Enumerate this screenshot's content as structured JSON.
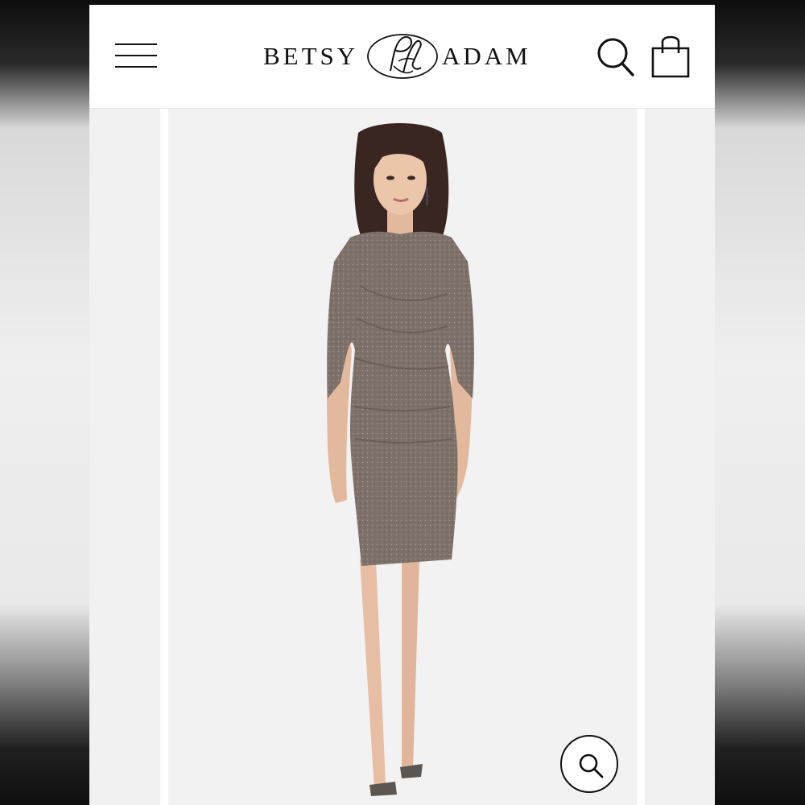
{
  "header": {
    "brand_left": "BETSY",
    "brand_right": "ADAM",
    "monogram_icon": "betsy-adam-monogram-icon",
    "menu_icon": "hamburger-menu-icon",
    "search_icon": "search-icon",
    "cart_icon": "shopping-bag-icon"
  },
  "gallery": {
    "zoom_icon": "zoom-magnifier-icon",
    "main_image": "model-in-gray-metallic-sheath-dress",
    "dress_color": "#7d716a",
    "background_color": "#f2f2f2"
  }
}
